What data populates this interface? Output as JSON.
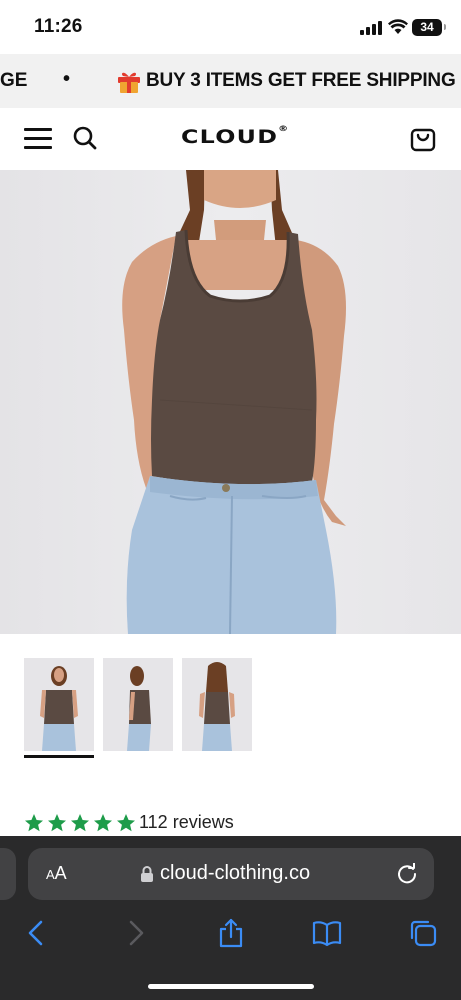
{
  "status_bar": {
    "time": "11:26",
    "battery": "34"
  },
  "promo": {
    "left_fragment": "GE",
    "separator": "•",
    "message": "BUY 3 ITEMS GET FREE SHIPPING"
  },
  "header": {
    "logo": "CLOUD",
    "logo_mark": "®"
  },
  "product": {
    "reviews_count_text": "112 reviews",
    "rating": 5,
    "rating_color": "#1e9c4a",
    "top_color": "#5a4a42",
    "jeans_color": "#a9c2dc"
  },
  "browser": {
    "text_size_label_small": "A",
    "text_size_label_large": "A",
    "url": "cloud-clothing.co"
  },
  "icons": {
    "menu": "hamburger-icon",
    "search": "search-icon",
    "bag": "shopping-bag-icon",
    "gift": "gift-icon",
    "lock": "lock-icon",
    "reload": "reload-icon",
    "back": "back-chevron-icon",
    "forward": "forward-chevron-icon",
    "share": "share-icon",
    "bookmarks": "book-icon",
    "tabs": "tabs-icon"
  }
}
